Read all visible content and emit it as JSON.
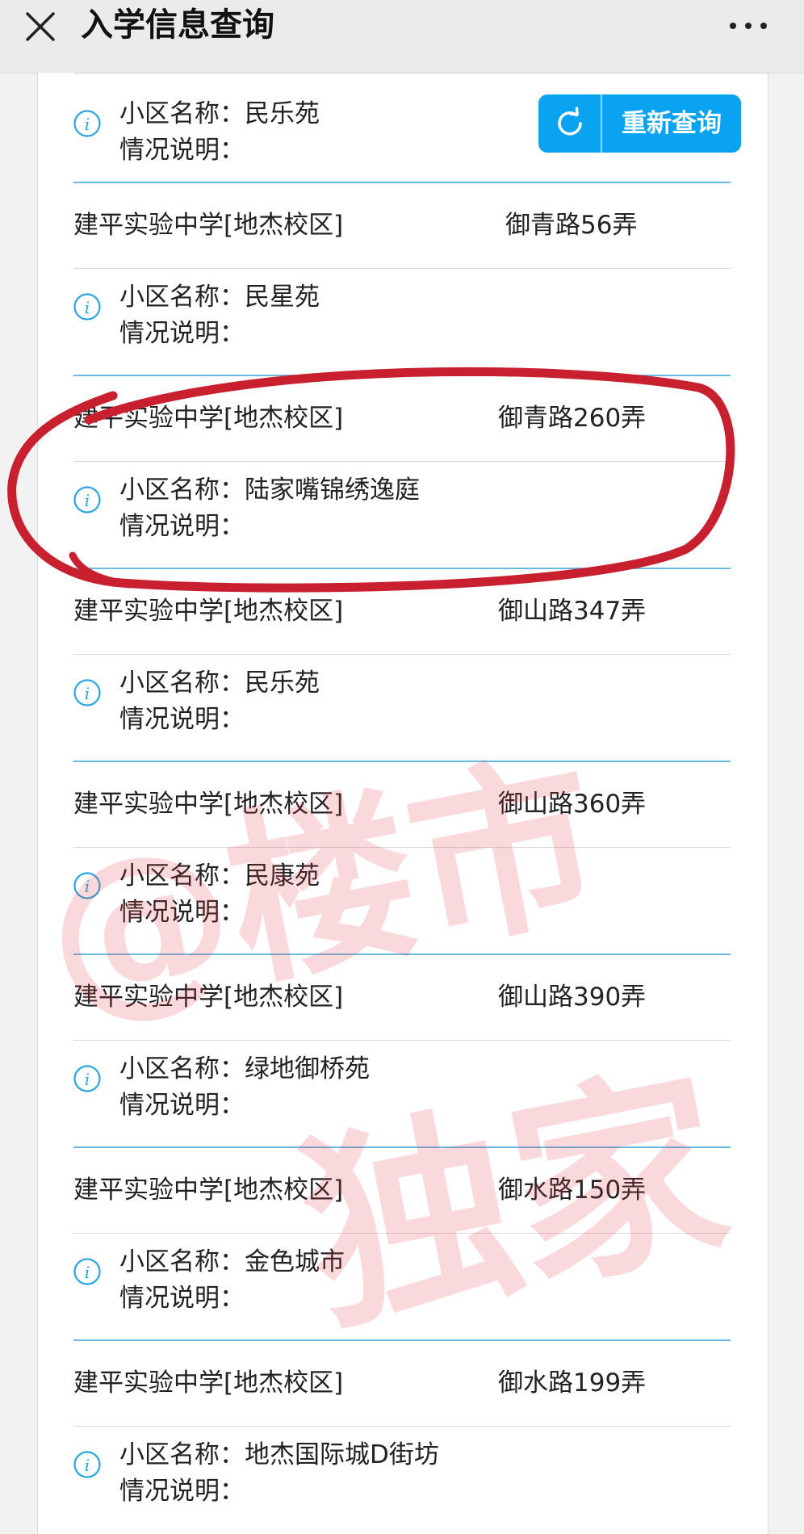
{
  "header": {
    "title": "入学信息查询",
    "close_icon": "close-icon",
    "more_icon": "more-icon"
  },
  "refresh_button": {
    "label": "重新查询",
    "icon": "refresh-icon",
    "color": "#0aa3f2"
  },
  "field_labels": {
    "community_prefix": "小区名称：",
    "note_label": "情况说明："
  },
  "first_community": "民乐苑",
  "records": [
    {
      "school": "建平实验中学[地杰校区]",
      "address": "御青路56弄",
      "community": "民星苑"
    },
    {
      "school": "建平实验中学[地杰校区]",
      "address": "御青路260弄",
      "community": "陆家嘴锦绣逸庭"
    },
    {
      "school": "建平实验中学[地杰校区]",
      "address": "御山路347弄",
      "community": "民乐苑"
    },
    {
      "school": "建平实验中学[地杰校区]",
      "address": "御山路360弄",
      "community": "民康苑"
    },
    {
      "school": "建平实验中学[地杰校区]",
      "address": "御山路390弄",
      "community": "绿地御桥苑"
    },
    {
      "school": "建平实验中学[地杰校区]",
      "address": "御水路150弄",
      "community": "金色城市"
    },
    {
      "school": "建平实验中学[地杰校区]",
      "address": "御水路199弄",
      "community": "地杰国际城D街坊"
    }
  ],
  "watermark": {
    "line1": "@楼市",
    "line2": "独家",
    "color": "#e8344a"
  },
  "annotation_color": "#c8202f",
  "accent_colors": {
    "info_icon": "#29a6e0",
    "separator": "#69b9e0"
  }
}
